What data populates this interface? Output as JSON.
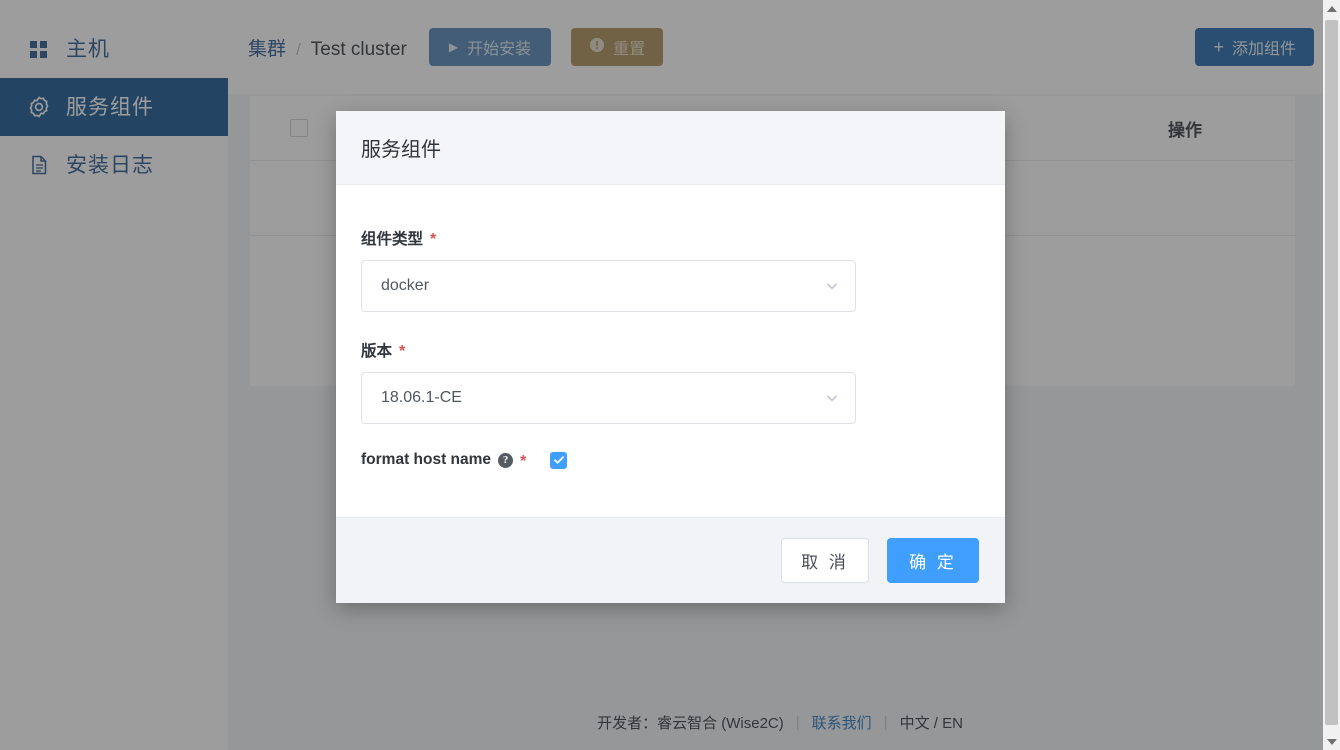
{
  "sidebar": {
    "items": [
      {
        "label": "主机",
        "icon": "grid-icon",
        "active": false
      },
      {
        "label": "服务组件",
        "icon": "gear-icon",
        "active": true
      },
      {
        "label": "安装日志",
        "icon": "document-icon",
        "active": false
      }
    ]
  },
  "topbar": {
    "breadcrumb_root": "集群",
    "breadcrumb_sep": "/",
    "breadcrumb_current": "Test cluster",
    "install_button": "开始安装",
    "reset_button": "重置",
    "add_component_button": "添加组件",
    "add_plus": "+",
    "play_glyph": "▶",
    "warn_glyph": "!"
  },
  "table": {
    "column_action": "操作",
    "select_all_checked": false
  },
  "modal": {
    "title": "服务组件",
    "fields": {
      "component_type_label": "组件类型",
      "component_type_value": "docker",
      "version_label": "版本",
      "version_value": "18.06.1-CE",
      "format_host_name_label": "format host name",
      "format_host_name_checked": true,
      "help_glyph": "?",
      "required_mark": "*"
    },
    "cancel_button": "取 消",
    "confirm_button": "确 定"
  },
  "footer": {
    "developer": "开发者：睿云智合 (Wise2C)",
    "divider": "|",
    "contact": "联系我们",
    "language": "中文 / EN"
  },
  "colors": {
    "sidebar_active": "#0b4f8a",
    "sidebar_text": "#1d4e89",
    "primary_blue": "#409eff",
    "install_blue": "#4b7fb3",
    "reset_brown": "#a8894f",
    "add_blue": "#1761a6",
    "required_red": "#d9534f"
  }
}
